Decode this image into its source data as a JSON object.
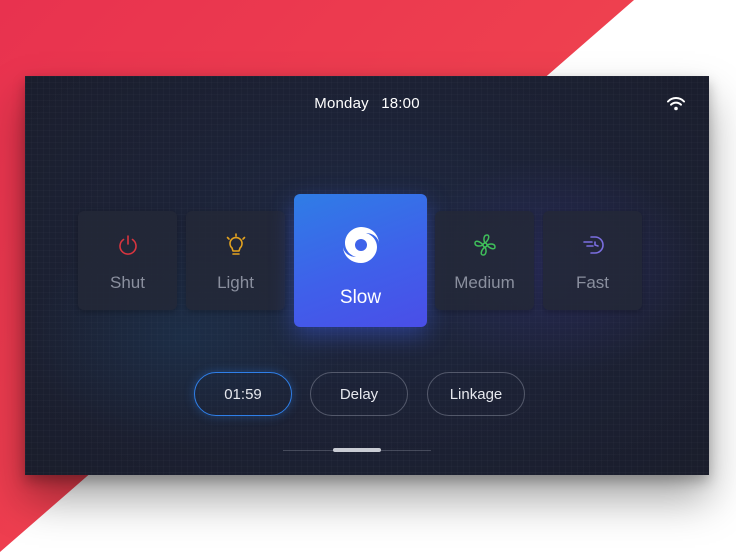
{
  "status_bar": {
    "day": "Monday",
    "time": "18:00",
    "wifi_icon": "wifi-icon"
  },
  "modes": [
    {
      "label": "Shut",
      "icon": "power-icon",
      "color": "#d9353f"
    },
    {
      "label": "Light",
      "icon": "lightbulb-icon",
      "color": "#e3a21f"
    },
    {
      "label": "Slow",
      "icon": "cyclone-icon",
      "color": "#ffffff",
      "selected": true
    },
    {
      "label": "Medium",
      "icon": "fan-icon",
      "color": "#3fbf5a"
    },
    {
      "label": "Fast",
      "icon": "speed-icon",
      "color": "#7b6ee0"
    }
  ],
  "controls": {
    "timer": "01:59",
    "delay": "Delay",
    "linkage": "Linkage"
  },
  "page_indicator": {
    "current": 1,
    "total": 3
  }
}
